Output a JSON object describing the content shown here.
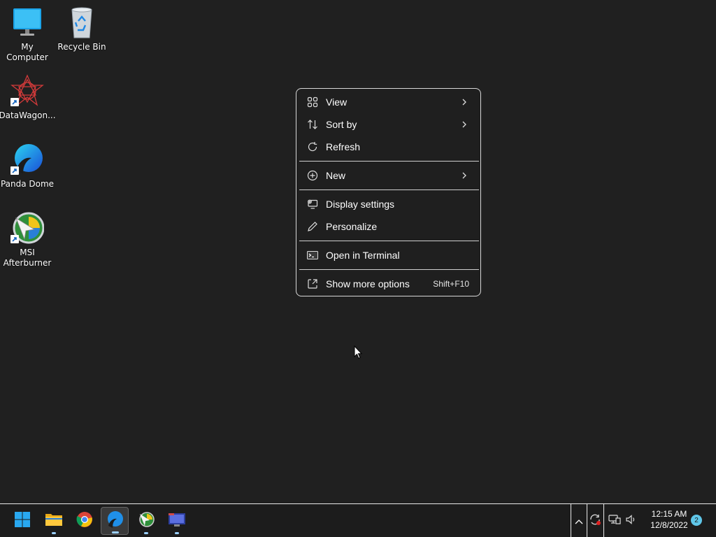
{
  "desktop": {
    "icons": [
      {
        "label": "My Computer",
        "icon": "monitor-icon"
      },
      {
        "label": "Recycle Bin",
        "icon": "recycle-bin-icon"
      },
      {
        "label": "DataWagon...",
        "icon": "datawagon-icon"
      },
      {
        "label": "Panda Dome",
        "icon": "panda-dome-icon"
      },
      {
        "label": "MSI Afterburner",
        "icon": "msi-afterburner-icon"
      }
    ]
  },
  "context_menu": {
    "items": [
      {
        "label": "View",
        "icon": "grid-icon",
        "submenu": true
      },
      {
        "label": "Sort by",
        "icon": "sort-icon",
        "submenu": true
      },
      {
        "label": "Refresh",
        "icon": "refresh-icon"
      },
      {
        "label": "New",
        "icon": "plus-circle-icon",
        "submenu": true
      },
      {
        "label": "Display settings",
        "icon": "display-settings-icon"
      },
      {
        "label": "Personalize",
        "icon": "pencil-icon"
      },
      {
        "label": "Open in Terminal",
        "icon": "terminal-icon"
      },
      {
        "label": "Show more options",
        "icon": "share-icon",
        "shortcut": "Shift+F10"
      }
    ]
  },
  "taskbar": {
    "apps": [
      "start-icon",
      "file-explorer-icon",
      "chrome-icon",
      "panda-dome-icon",
      "msi-afterburner-icon",
      "remote-desktop-icon"
    ],
    "clock": {
      "time": "12:15 AM",
      "date": "12/8/2022"
    },
    "notification_count": "2"
  },
  "colors": {
    "background": "#202020",
    "menu_bg": "#1f1f1f",
    "accent": "#0078d4"
  }
}
